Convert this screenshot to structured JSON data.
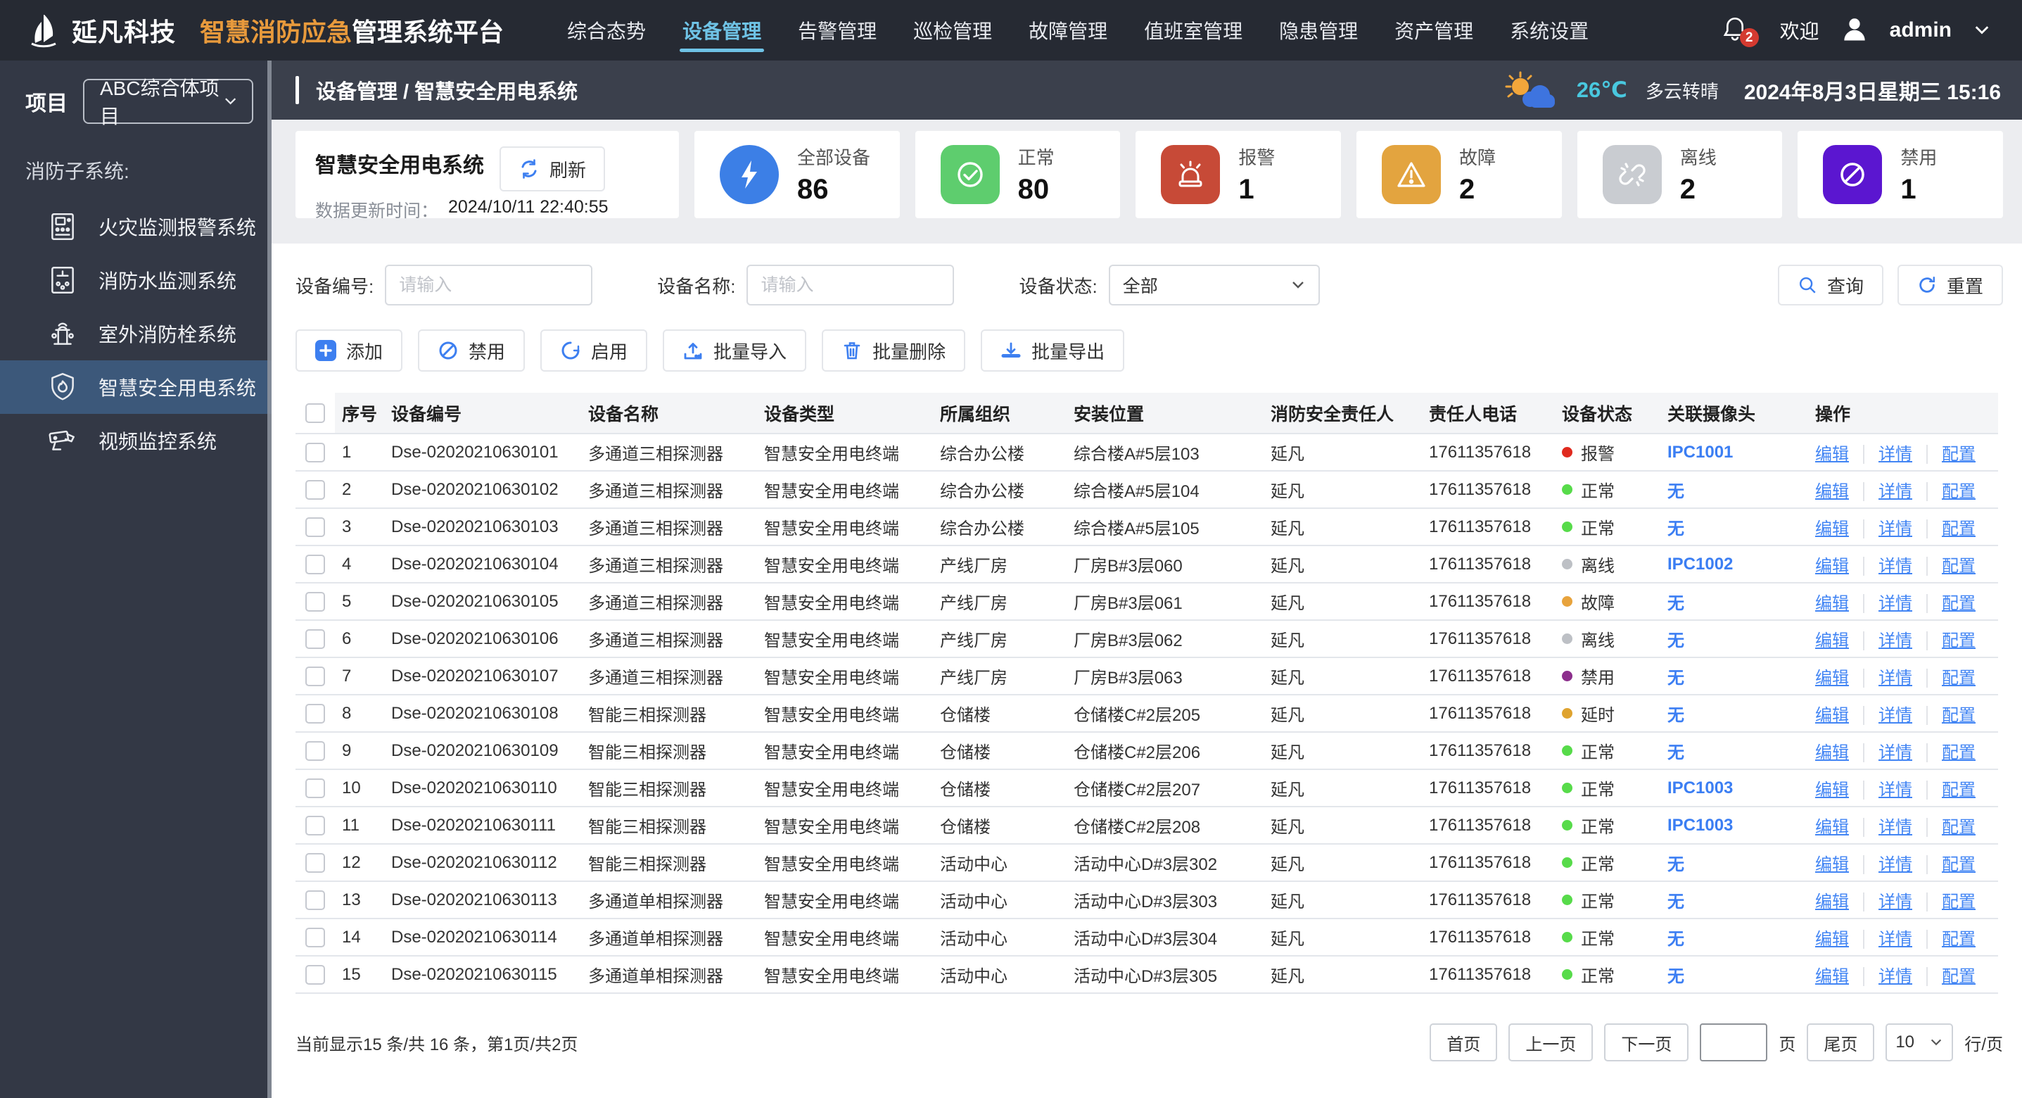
{
  "app": {
    "brand_name": "延凡科技",
    "title_highlight": "智慧消防应急",
    "title_rest": "管理系统平台"
  },
  "nav": {
    "items": [
      {
        "label": "综合态势",
        "active": false
      },
      {
        "label": "设备管理",
        "active": true
      },
      {
        "label": "告警管理",
        "active": false
      },
      {
        "label": "巡检管理",
        "active": false
      },
      {
        "label": "故障管理",
        "active": false
      },
      {
        "label": "值班室管理",
        "active": false
      },
      {
        "label": "隐患管理",
        "active": false
      },
      {
        "label": "资产管理",
        "active": false
      },
      {
        "label": "系统设置",
        "active": false
      }
    ],
    "badge_count": "2",
    "welcome": "欢迎",
    "username": "admin"
  },
  "sidebar": {
    "project_label": "项目",
    "project_value": "ABC综合体项目",
    "section_title": "消防子系统:",
    "items": [
      {
        "label": "火灾监测报警系统",
        "icon": "fire-alarm-panel-icon",
        "active": false
      },
      {
        "label": "消防水监测系统",
        "icon": "water-monitor-icon",
        "active": false
      },
      {
        "label": "室外消防栓系统",
        "icon": "hydrant-icon",
        "active": false
      },
      {
        "label": "智慧安全用电系统",
        "icon": "shield-flame-icon",
        "active": true
      },
      {
        "label": "视频监控系统",
        "icon": "cctv-icon",
        "active": false
      }
    ]
  },
  "breadcrumb": {
    "path": "设备管理 / 智慧安全用电系统"
  },
  "topinfo": {
    "temperature": "26℃",
    "weather": "多云转晴",
    "datetime": "2024年8月3日星期三 15:16"
  },
  "overview": {
    "title": "智慧安全用电系统",
    "refresh_label": "刷新",
    "update_time_label": "数据更新时间：",
    "update_time": "2024/10/11 22:40:55",
    "stats": [
      {
        "label": "全部设备",
        "value": "86",
        "color": "#3C7FE6",
        "shape": "circle",
        "icon": "bolt-icon"
      },
      {
        "label": "正常",
        "value": "80",
        "color": "#5ECD6E",
        "shape": "rounded",
        "icon": "check-circle-icon"
      },
      {
        "label": "报警",
        "value": "1",
        "color": "#C74A37",
        "shape": "rounded",
        "icon": "siren-icon"
      },
      {
        "label": "故障",
        "value": "2",
        "color": "#E3A43F",
        "shape": "rounded",
        "icon": "warning-icon"
      },
      {
        "label": "离线",
        "value": "2",
        "color": "#C9CCD1",
        "shape": "rounded",
        "icon": "offline-icon"
      },
      {
        "label": "禁用",
        "value": "1",
        "color": "#5B16D0",
        "shape": "rounded",
        "icon": "forbid-icon"
      }
    ]
  },
  "filters": {
    "device_no_label": "设备编号:",
    "device_no_placeholder": "请输入",
    "device_name_label": "设备名称:",
    "device_name_placeholder": "请输入",
    "status_label": "设备状态:",
    "status_value": "全部",
    "search_label": "查询",
    "reset_label": "重置"
  },
  "actions": [
    {
      "label": "添加",
      "icon": "plus-icon"
    },
    {
      "label": "禁用",
      "icon": "ban-icon"
    },
    {
      "label": "启用",
      "icon": "enable-icon"
    },
    {
      "label": "批量导入",
      "icon": "import-icon"
    },
    {
      "label": "批量删除",
      "icon": "trash-icon"
    },
    {
      "label": "批量导出",
      "icon": "export-icon"
    }
  ],
  "table": {
    "columns": [
      "序号",
      "设备编号",
      "设备名称",
      "设备类型",
      "所属组织",
      "安装位置",
      "消防安全责任人",
      "责任人电话",
      "设备状态",
      "关联摄像头",
      "操作"
    ],
    "action_labels": [
      "编辑",
      "详情",
      "配置"
    ],
    "status_colors": {
      "报警": "#E02A1E",
      "正常": "#57DB4A",
      "离线": "#BDC0C5",
      "故障": "#E8A33C",
      "延时": "#DFA32F",
      "禁用": "#8C2F8C"
    },
    "rows": [
      {
        "no": "1",
        "code": "Dse-02020210630101",
        "name": "多通道三相探测器",
        "type": "智慧安全用电终端",
        "org": "综合办公楼",
        "location": "综合楼A#5层103",
        "person": "延凡",
        "phone": "17611357618",
        "status": "报警",
        "camera": "IPC1001"
      },
      {
        "no": "2",
        "code": "Dse-02020210630102",
        "name": "多通道三相探测器",
        "type": "智慧安全用电终端",
        "org": "综合办公楼",
        "location": "综合楼A#5层104",
        "person": "延凡",
        "phone": "17611357618",
        "status": "正常",
        "camera": "无"
      },
      {
        "no": "3",
        "code": "Dse-02020210630103",
        "name": "多通道三相探测器",
        "type": "智慧安全用电终端",
        "org": "综合办公楼",
        "location": "综合楼A#5层105",
        "person": "延凡",
        "phone": "17611357618",
        "status": "正常",
        "camera": "无"
      },
      {
        "no": "4",
        "code": "Dse-02020210630104",
        "name": "多通道三相探测器",
        "type": "智慧安全用电终端",
        "org": "产线厂房",
        "location": "厂房B#3层060",
        "person": "延凡",
        "phone": "17611357618",
        "status": "离线",
        "camera": "IPC1002"
      },
      {
        "no": "5",
        "code": "Dse-02020210630105",
        "name": "多通道三相探测器",
        "type": "智慧安全用电终端",
        "org": "产线厂房",
        "location": "厂房B#3层061",
        "person": "延凡",
        "phone": "17611357618",
        "status": "故障",
        "camera": "无"
      },
      {
        "no": "6",
        "code": "Dse-02020210630106",
        "name": "多通道三相探测器",
        "type": "智慧安全用电终端",
        "org": "产线厂房",
        "location": "厂房B#3层062",
        "person": "延凡",
        "phone": "17611357618",
        "status": "离线",
        "camera": "无"
      },
      {
        "no": "7",
        "code": "Dse-02020210630107",
        "name": "多通道三相探测器",
        "type": "智慧安全用电终端",
        "org": "产线厂房",
        "location": "厂房B#3层063",
        "person": "延凡",
        "phone": "17611357618",
        "status": "禁用",
        "camera": "无"
      },
      {
        "no": "8",
        "code": "Dse-02020210630108",
        "name": "智能三相探测器",
        "type": "智慧安全用电终端",
        "org": "仓储楼",
        "location": "仓储楼C#2层205",
        "person": "延凡",
        "phone": "17611357618",
        "status": "延时",
        "camera": "无"
      },
      {
        "no": "9",
        "code": "Dse-02020210630109",
        "name": "智能三相探测器",
        "type": "智慧安全用电终端",
        "org": "仓储楼",
        "location": "仓储楼C#2层206",
        "person": "延凡",
        "phone": "17611357618",
        "status": "正常",
        "camera": "无"
      },
      {
        "no": "10",
        "code": "Dse-02020210630110",
        "name": "智能三相探测器",
        "type": "智慧安全用电终端",
        "org": "仓储楼",
        "location": "仓储楼C#2层207",
        "person": "延凡",
        "phone": "17611357618",
        "status": "正常",
        "camera": "IPC1003"
      },
      {
        "no": "11",
        "code": "Dse-02020210630111",
        "name": "智能三相探测器",
        "type": "智慧安全用电终端",
        "org": "仓储楼",
        "location": "仓储楼C#2层208",
        "person": "延凡",
        "phone": "17611357618",
        "status": "正常",
        "camera": "IPC1003"
      },
      {
        "no": "12",
        "code": "Dse-02020210630112",
        "name": "智能三相探测器",
        "type": "智慧安全用电终端",
        "org": "活动中心",
        "location": "活动中心D#3层302",
        "person": "延凡",
        "phone": "17611357618",
        "status": "正常",
        "camera": "无"
      },
      {
        "no": "13",
        "code": "Dse-02020210630113",
        "name": "多通道单相探测器",
        "type": "智慧安全用电终端",
        "org": "活动中心",
        "location": "活动中心D#3层303",
        "person": "延凡",
        "phone": "17611357618",
        "status": "正常",
        "camera": "无"
      },
      {
        "no": "14",
        "code": "Dse-02020210630114",
        "name": "多通道单相探测器",
        "type": "智慧安全用电终端",
        "org": "活动中心",
        "location": "活动中心D#3层304",
        "person": "延凡",
        "phone": "17611357618",
        "status": "正常",
        "camera": "无"
      },
      {
        "no": "15",
        "code": "Dse-02020210630115",
        "name": "多通道单相探测器",
        "type": "智慧安全用电终端",
        "org": "活动中心",
        "location": "活动中心D#3层305",
        "person": "延凡",
        "phone": "17611357618",
        "status": "正常",
        "camera": "无"
      }
    ]
  },
  "pagination": {
    "summary": "当前显示15 条/共 16 条，第1页/共2页",
    "first_label": "首页",
    "prev_label": "上一页",
    "next_label": "下一页",
    "page_suffix": "页",
    "last_label": "尾页",
    "page_size": "10",
    "rows_suffix": "行/页"
  }
}
